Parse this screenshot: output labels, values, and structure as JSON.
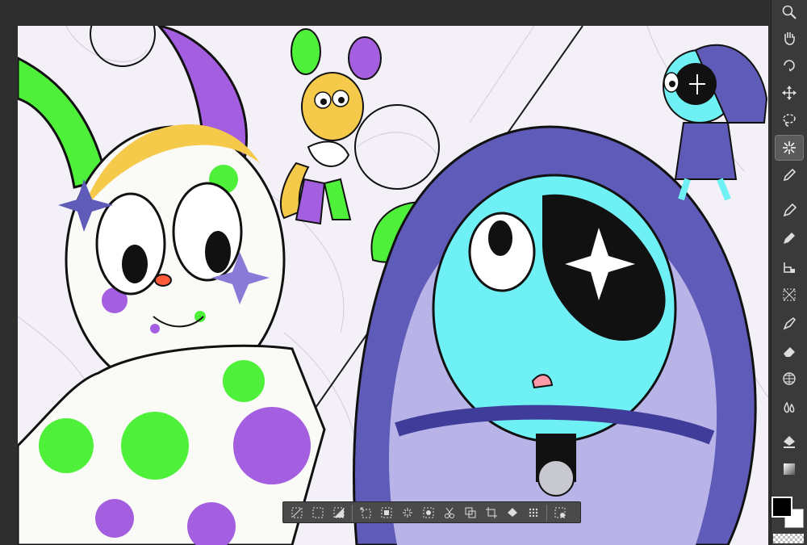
{
  "app": {
    "active_tool": "auto-select"
  },
  "colors": {
    "ui_background": "#2e2e2e",
    "toolbar_background": "#3a3a3a",
    "canvas_background": "#f4f0f8",
    "primary_color": "#000000",
    "secondary_color": "#ffffff",
    "accent_green": "#4ef03a",
    "accent_purple": "#a45fe0",
    "accent_cyan": "#6ff0f4",
    "accent_hood": "#5e5cb8"
  },
  "toolbar": {
    "tools": [
      {
        "id": "zoom",
        "icon": "magnifier-icon"
      },
      {
        "id": "hand",
        "icon": "hand-icon"
      },
      {
        "id": "rotate",
        "icon": "rotate-icon"
      },
      {
        "id": "move",
        "icon": "move-icon"
      },
      {
        "id": "lasso",
        "icon": "lasso-icon"
      },
      {
        "id": "auto-select",
        "icon": "magic-wand-icon"
      },
      {
        "id": "eyedropper",
        "icon": "eyedropper-icon"
      },
      {
        "id": "pen",
        "icon": "pen-icon"
      },
      {
        "id": "pencil",
        "icon": "pencil-icon"
      },
      {
        "id": "brush",
        "icon": "brush-icon"
      },
      {
        "id": "airbrush",
        "icon": "airbrush-icon"
      },
      {
        "id": "decoration",
        "icon": "decoration-icon"
      },
      {
        "id": "eraser",
        "icon": "eraser-icon"
      },
      {
        "id": "blend",
        "icon": "blend-icon"
      },
      {
        "id": "fill",
        "icon": "fill-bucket-icon"
      },
      {
        "id": "gradient",
        "icon": "gradient-icon"
      }
    ]
  },
  "selection_bar": {
    "buttons": [
      "deselect-icon",
      "select-all-icon",
      "invert-selection-icon",
      "expand-selection-icon",
      "shrink-selection-icon",
      "auto-select-icon",
      "mask-icon",
      "cut-icon",
      "copy-icon",
      "crop-icon",
      "fill-selection-icon",
      "screen-tone-icon",
      "settings-icon"
    ]
  }
}
